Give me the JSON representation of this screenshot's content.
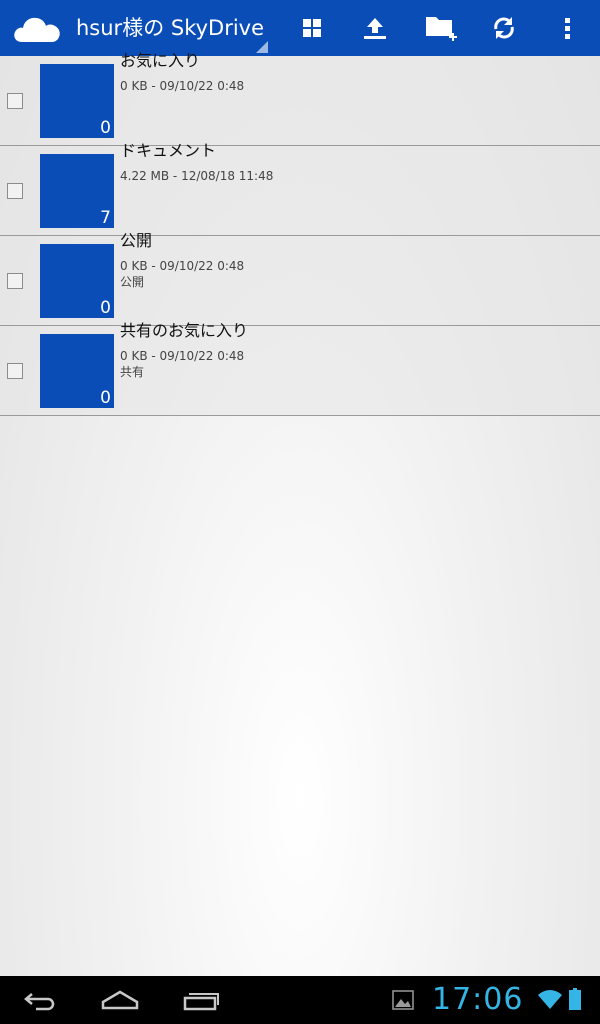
{
  "app": {
    "title": "hsur様の SkyDrive"
  },
  "toolbar": {
    "icons": [
      "grid-view-icon",
      "upload-icon",
      "new-folder-icon",
      "refresh-icon",
      "overflow-menu-icon"
    ]
  },
  "folders": [
    {
      "name": "お気に入り",
      "meta": "0 KB - 09/10/22 0:48",
      "tag": "",
      "count": "0"
    },
    {
      "name": "ドキュメント",
      "meta": "4.22 MB - 12/08/18 11:48",
      "tag": "",
      "count": "7"
    },
    {
      "name": "公開",
      "meta": "0 KB - 09/10/22 0:48",
      "tag": "公開",
      "count": "0"
    },
    {
      "name": "共有のお気に入り",
      "meta": "0 KB - 09/10/22 0:48",
      "tag": "共有",
      "count": "0"
    }
  ],
  "status": {
    "time": "17:06"
  },
  "colors": {
    "brand": "#0b4db7",
    "clock": "#35b5e5"
  }
}
